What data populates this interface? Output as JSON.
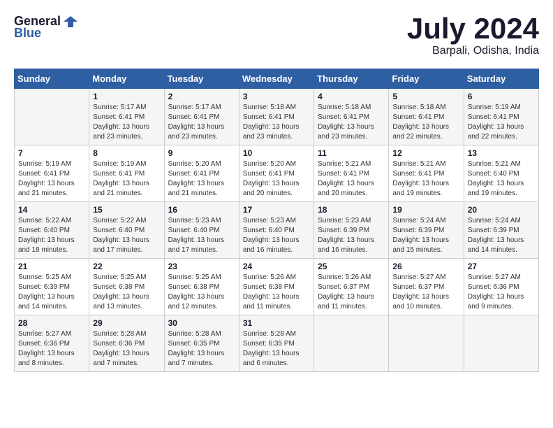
{
  "header": {
    "logo_line1": "General",
    "logo_line2": "Blue",
    "month_title": "July 2024",
    "location": "Barpali, Odisha, India"
  },
  "weekdays": [
    "Sunday",
    "Monday",
    "Tuesday",
    "Wednesday",
    "Thursday",
    "Friday",
    "Saturday"
  ],
  "weeks": [
    [
      {
        "day": "",
        "info": ""
      },
      {
        "day": "1",
        "info": "Sunrise: 5:17 AM\nSunset: 6:41 PM\nDaylight: 13 hours\nand 23 minutes."
      },
      {
        "day": "2",
        "info": "Sunrise: 5:17 AM\nSunset: 6:41 PM\nDaylight: 13 hours\nand 23 minutes."
      },
      {
        "day": "3",
        "info": "Sunrise: 5:18 AM\nSunset: 6:41 PM\nDaylight: 13 hours\nand 23 minutes."
      },
      {
        "day": "4",
        "info": "Sunrise: 5:18 AM\nSunset: 6:41 PM\nDaylight: 13 hours\nand 23 minutes."
      },
      {
        "day": "5",
        "info": "Sunrise: 5:18 AM\nSunset: 6:41 PM\nDaylight: 13 hours\nand 22 minutes."
      },
      {
        "day": "6",
        "info": "Sunrise: 5:19 AM\nSunset: 6:41 PM\nDaylight: 13 hours\nand 22 minutes."
      }
    ],
    [
      {
        "day": "7",
        "info": "Sunrise: 5:19 AM\nSunset: 6:41 PM\nDaylight: 13 hours\nand 21 minutes."
      },
      {
        "day": "8",
        "info": "Sunrise: 5:19 AM\nSunset: 6:41 PM\nDaylight: 13 hours\nand 21 minutes."
      },
      {
        "day": "9",
        "info": "Sunrise: 5:20 AM\nSunset: 6:41 PM\nDaylight: 13 hours\nand 21 minutes."
      },
      {
        "day": "10",
        "info": "Sunrise: 5:20 AM\nSunset: 6:41 PM\nDaylight: 13 hours\nand 20 minutes."
      },
      {
        "day": "11",
        "info": "Sunrise: 5:21 AM\nSunset: 6:41 PM\nDaylight: 13 hours\nand 20 minutes."
      },
      {
        "day": "12",
        "info": "Sunrise: 5:21 AM\nSunset: 6:41 PM\nDaylight: 13 hours\nand 19 minutes."
      },
      {
        "day": "13",
        "info": "Sunrise: 5:21 AM\nSunset: 6:40 PM\nDaylight: 13 hours\nand 19 minutes."
      }
    ],
    [
      {
        "day": "14",
        "info": "Sunrise: 5:22 AM\nSunset: 6:40 PM\nDaylight: 13 hours\nand 18 minutes."
      },
      {
        "day": "15",
        "info": "Sunrise: 5:22 AM\nSunset: 6:40 PM\nDaylight: 13 hours\nand 17 minutes."
      },
      {
        "day": "16",
        "info": "Sunrise: 5:23 AM\nSunset: 6:40 PM\nDaylight: 13 hours\nand 17 minutes."
      },
      {
        "day": "17",
        "info": "Sunrise: 5:23 AM\nSunset: 6:40 PM\nDaylight: 13 hours\nand 16 minutes."
      },
      {
        "day": "18",
        "info": "Sunrise: 5:23 AM\nSunset: 6:39 PM\nDaylight: 13 hours\nand 16 minutes."
      },
      {
        "day": "19",
        "info": "Sunrise: 5:24 AM\nSunset: 6:39 PM\nDaylight: 13 hours\nand 15 minutes."
      },
      {
        "day": "20",
        "info": "Sunrise: 5:24 AM\nSunset: 6:39 PM\nDaylight: 13 hours\nand 14 minutes."
      }
    ],
    [
      {
        "day": "21",
        "info": "Sunrise: 5:25 AM\nSunset: 6:39 PM\nDaylight: 13 hours\nand 14 minutes."
      },
      {
        "day": "22",
        "info": "Sunrise: 5:25 AM\nSunset: 6:38 PM\nDaylight: 13 hours\nand 13 minutes."
      },
      {
        "day": "23",
        "info": "Sunrise: 5:25 AM\nSunset: 6:38 PM\nDaylight: 13 hours\nand 12 minutes."
      },
      {
        "day": "24",
        "info": "Sunrise: 5:26 AM\nSunset: 6:38 PM\nDaylight: 13 hours\nand 11 minutes."
      },
      {
        "day": "25",
        "info": "Sunrise: 5:26 AM\nSunset: 6:37 PM\nDaylight: 13 hours\nand 11 minutes."
      },
      {
        "day": "26",
        "info": "Sunrise: 5:27 AM\nSunset: 6:37 PM\nDaylight: 13 hours\nand 10 minutes."
      },
      {
        "day": "27",
        "info": "Sunrise: 5:27 AM\nSunset: 6:36 PM\nDaylight: 13 hours\nand 9 minutes."
      }
    ],
    [
      {
        "day": "28",
        "info": "Sunrise: 5:27 AM\nSunset: 6:36 PM\nDaylight: 13 hours\nand 8 minutes."
      },
      {
        "day": "29",
        "info": "Sunrise: 5:28 AM\nSunset: 6:36 PM\nDaylight: 13 hours\nand 7 minutes."
      },
      {
        "day": "30",
        "info": "Sunrise: 5:28 AM\nSunset: 6:35 PM\nDaylight: 13 hours\nand 7 minutes."
      },
      {
        "day": "31",
        "info": "Sunrise: 5:28 AM\nSunset: 6:35 PM\nDaylight: 13 hours\nand 6 minutes."
      },
      {
        "day": "",
        "info": ""
      },
      {
        "day": "",
        "info": ""
      },
      {
        "day": "",
        "info": ""
      }
    ]
  ]
}
